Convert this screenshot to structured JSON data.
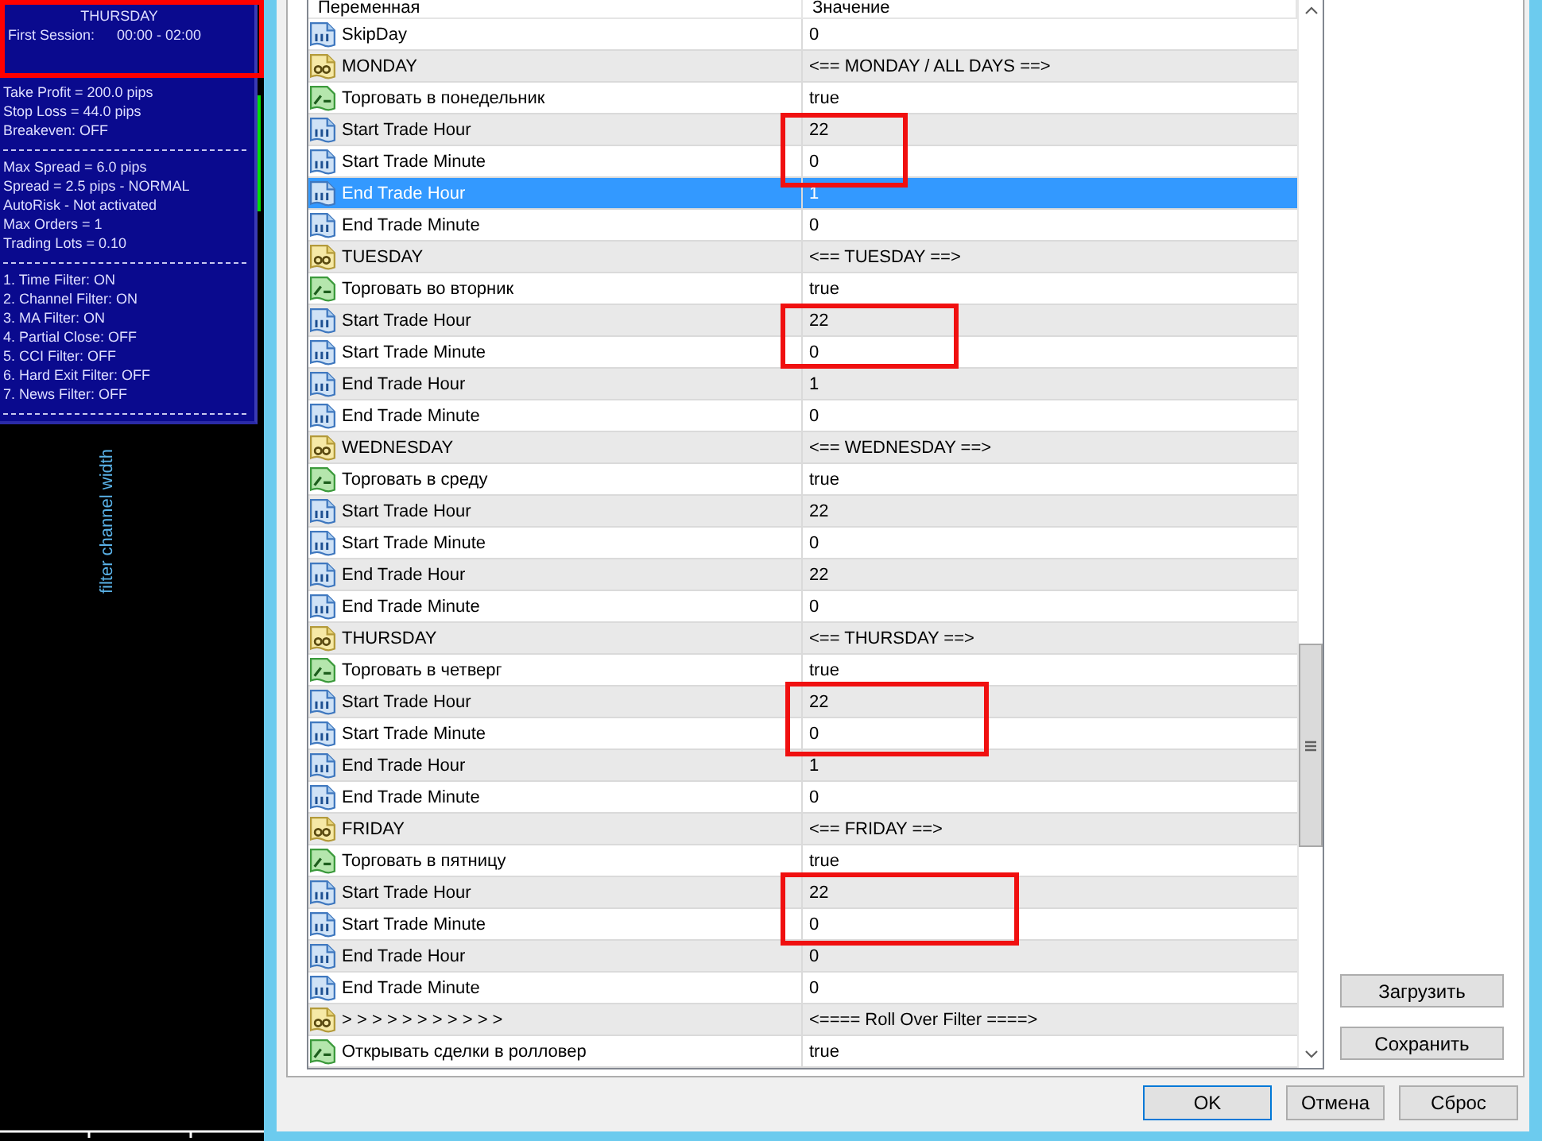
{
  "info_panel": {
    "title": "THURSDAY",
    "session_label": "First Session:",
    "session_time": "00:00 - 02:00",
    "highlighted": true,
    "sections": [
      {
        "lines": [
          "Take Profit = 200.0 pips",
          "Stop Loss = 44.0 pips",
          "Breakeven: OFF"
        ]
      },
      {
        "lines": [
          "Max Spread = 6.0 pips",
          "Spread = 2.5 pips - NORMAL",
          "AutoRisk - Not activated",
          "Max Orders = 1",
          "Trading Lots = 0.10"
        ]
      },
      {
        "lines": [
          "1. Time Filter: ON",
          "2. Channel Filter: ON",
          "3. MA Filter: ON",
          "4. Partial Close: OFF",
          "5. CCI Filter: OFF",
          "6. Hard Exit Filter: OFF",
          "7. News Filter: OFF"
        ]
      }
    ]
  },
  "chart": {
    "indicator_label": "filter channel width"
  },
  "parameters_table": {
    "columns": [
      "Переменная",
      "Значение"
    ],
    "rows": [
      {
        "kind": "number",
        "name": "SkipDay",
        "value": "0",
        "selected": false,
        "highlighted": false
      },
      {
        "kind": "text",
        "name": "MONDAY",
        "value": "<== MONDAY / ALL DAYS ==>",
        "selected": false,
        "highlighted": false
      },
      {
        "kind": "bool",
        "name": "Торговать в понедельник",
        "value": "true",
        "selected": false,
        "highlighted": false
      },
      {
        "kind": "number",
        "name": "Start Trade Hour",
        "value": "22",
        "selected": false,
        "highlighted": true
      },
      {
        "kind": "number",
        "name": "Start Trade Minute",
        "value": "0",
        "selected": false,
        "highlighted": true
      },
      {
        "kind": "number",
        "name": "End Trade Hour",
        "value": "1",
        "selected": true,
        "highlighted": false
      },
      {
        "kind": "number",
        "name": "End Trade Minute",
        "value": "0",
        "selected": false,
        "highlighted": false
      },
      {
        "kind": "text",
        "name": "TUESDAY",
        "value": "<== TUESDAY ==>",
        "selected": false,
        "highlighted": false
      },
      {
        "kind": "bool",
        "name": "Торговать во вторник",
        "value": "true",
        "selected": false,
        "highlighted": false
      },
      {
        "kind": "number",
        "name": "Start Trade Hour",
        "value": "22",
        "selected": false,
        "highlighted": true
      },
      {
        "kind": "number",
        "name": "Start Trade Minute",
        "value": "0",
        "selected": false,
        "highlighted": true
      },
      {
        "kind": "number",
        "name": "End Trade Hour",
        "value": "1",
        "selected": false,
        "highlighted": false
      },
      {
        "kind": "number",
        "name": "End Trade Minute",
        "value": "0",
        "selected": false,
        "highlighted": false
      },
      {
        "kind": "text",
        "name": "WEDNESDAY",
        "value": "<== WEDNESDAY ==>",
        "selected": false,
        "highlighted": false
      },
      {
        "kind": "bool",
        "name": "Торговать в среду",
        "value": "true",
        "selected": false,
        "highlighted": false
      },
      {
        "kind": "number",
        "name": "Start Trade Hour",
        "value": "22",
        "selected": false,
        "highlighted": false
      },
      {
        "kind": "number",
        "name": "Start Trade Minute",
        "value": "0",
        "selected": false,
        "highlighted": false
      },
      {
        "kind": "number",
        "name": "End Trade Hour",
        "value": "22",
        "selected": false,
        "highlighted": false
      },
      {
        "kind": "number",
        "name": "End Trade Minute",
        "value": "0",
        "selected": false,
        "highlighted": false
      },
      {
        "kind": "text",
        "name": "THURSDAY",
        "value": "<== THURSDAY ==>",
        "selected": false,
        "highlighted": false
      },
      {
        "kind": "bool",
        "name": "Торговать в четверг",
        "value": "true",
        "selected": false,
        "highlighted": false
      },
      {
        "kind": "number",
        "name": "Start Trade Hour",
        "value": "22",
        "selected": false,
        "highlighted": true
      },
      {
        "kind": "number",
        "name": "Start Trade Minute",
        "value": "0",
        "selected": false,
        "highlighted": true
      },
      {
        "kind": "number",
        "name": "End Trade Hour",
        "value": "1",
        "selected": false,
        "highlighted": false
      },
      {
        "kind": "number",
        "name": "End Trade Minute",
        "value": "0",
        "selected": false,
        "highlighted": false
      },
      {
        "kind": "text",
        "name": "FRIDAY",
        "value": "<== FRIDAY ==>",
        "selected": false,
        "highlighted": false
      },
      {
        "kind": "bool",
        "name": "Торговать в пятницу",
        "value": "true",
        "selected": false,
        "highlighted": false
      },
      {
        "kind": "number",
        "name": "Start Trade Hour",
        "value": "22",
        "selected": false,
        "highlighted": true
      },
      {
        "kind": "number",
        "name": "Start Trade Minute",
        "value": "0",
        "selected": false,
        "highlighted": true
      },
      {
        "kind": "number",
        "name": "End Trade Hour",
        "value": "0",
        "selected": false,
        "highlighted": false
      },
      {
        "kind": "number",
        "name": "End Trade Minute",
        "value": "0",
        "selected": false,
        "highlighted": false
      },
      {
        "kind": "text",
        "name": "> > > > > > > > > > >",
        "value": "<==== Roll Over Filter ====>",
        "selected": false,
        "highlighted": false
      },
      {
        "kind": "bool",
        "name": "Открывать сделки в ролловер",
        "value": "true",
        "selected": false,
        "highlighted": false
      }
    ]
  },
  "side_buttons": [
    {
      "label": "Загрузить"
    },
    {
      "label": "Сохранить"
    }
  ],
  "dialog_buttons": [
    {
      "label": "OK",
      "default": true
    },
    {
      "label": "Отмена",
      "default": false
    },
    {
      "label": "Сброс",
      "default": false
    }
  ]
}
